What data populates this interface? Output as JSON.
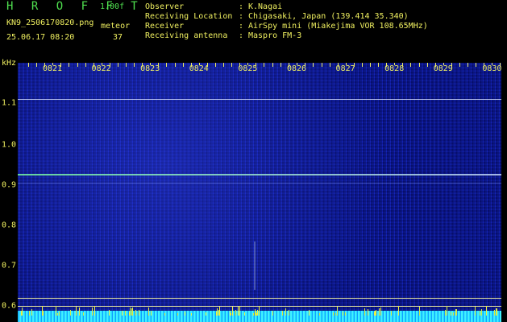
{
  "app": {
    "title": "HROFFT",
    "version": "1.00f"
  },
  "file": {
    "name": "KN9_2506170820.png",
    "timestamp": "25.06.17 08:20"
  },
  "meteor": {
    "label": "meteor",
    "count": "37"
  },
  "info": {
    "observer": {
      "key": "Observer",
      "value": "K.Nagai"
    },
    "location": {
      "key": "Receiving Location",
      "value": "Chigasaki, Japan (139.414 35.340)"
    },
    "receiver": {
      "key": "Receiver",
      "value": "AirSpy mini (Miakejima VOR 108.65MHz)"
    },
    "antenna": {
      "key": "Receiving antenna",
      "value": "Maspro FM-3"
    },
    "separator": ":"
  },
  "axis": {
    "unit": "kHz",
    "y_ticks": [
      "1.1",
      "1.0",
      "0.9",
      "0.8",
      "0.7",
      "0.6"
    ],
    "x_ticks": [
      "0821",
      "0822",
      "0823",
      "0824",
      "0825",
      "0826",
      "0827",
      "0828",
      "0829",
      "0830"
    ]
  },
  "colors": {
    "label": "#f0f060",
    "title": "#4fe04f",
    "background": "#0a1a9a"
  }
}
